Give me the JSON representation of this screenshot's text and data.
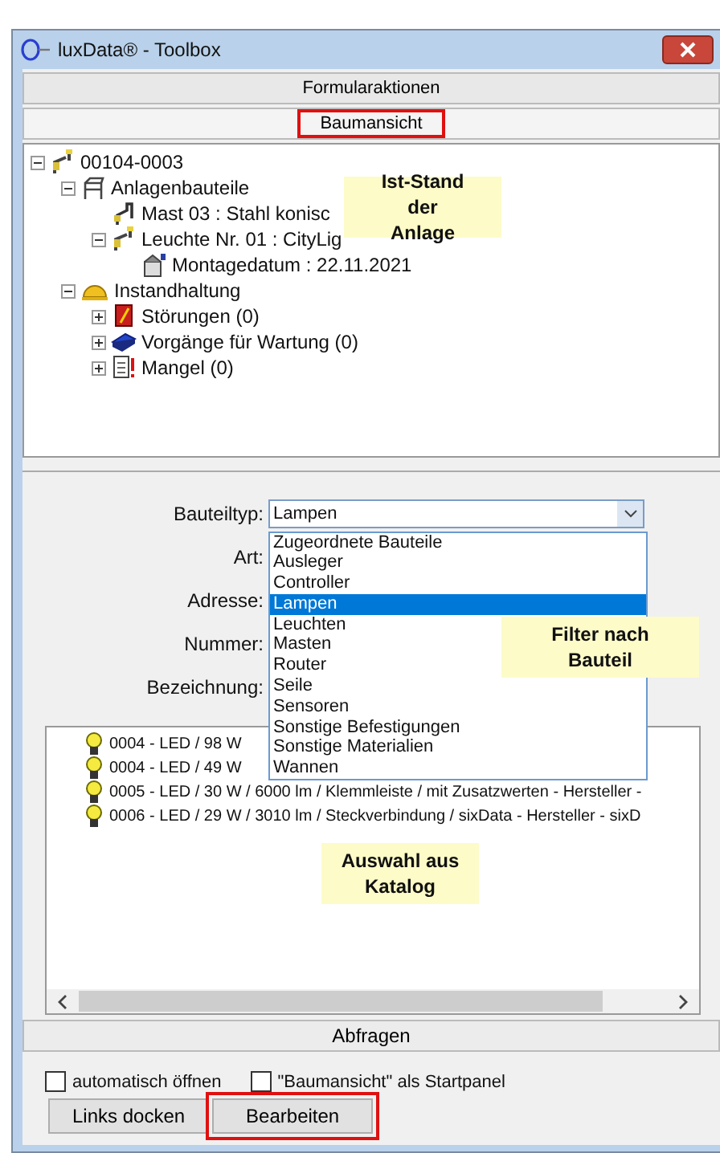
{
  "window": {
    "title": "luxData® - Toolbox"
  },
  "panels": [
    {
      "label": "Formularaktionen",
      "selected": false,
      "highlighted": false
    },
    {
      "label": "Baumansicht",
      "selected": true,
      "highlighted": true
    }
  ],
  "tree": {
    "nodes": [
      {
        "label": "00104-0003",
        "kind": "pole",
        "expanded": true,
        "children": [
          {
            "label": "Anlagenbauteile",
            "kind": "assembly",
            "expanded": true,
            "children": [
              {
                "label": "Mast 03 : Stahl konisc",
                "kind": "mast"
              },
              {
                "label": "Leuchte Nr. 01 : CityLig",
                "kind": "pole",
                "expanded": true,
                "children": [
                  {
                    "label": "Montagedatum : 22.11.2021",
                    "kind": "date"
                  }
                ]
              }
            ]
          },
          {
            "label": "Instandhaltung",
            "kind": "helmet",
            "expanded": true,
            "children": [
              {
                "label": "Störungen (0)",
                "kind": "fault",
                "expanded": false
              },
              {
                "label": "Vorgänge für Wartung (0)",
                "kind": "book",
                "expanded": false
              },
              {
                "label": "Mangel (0)",
                "kind": "defect",
                "expanded": false
              }
            ]
          }
        ]
      }
    ]
  },
  "callouts": [
    {
      "text": "Ist-Stand der Anlage"
    },
    {
      "text": "Filter nach Bauteil"
    },
    {
      "text": "Auswahl aus Katalog"
    }
  ],
  "filter": {
    "fields": [
      {
        "label": "Bauteiltyp:",
        "kind": "combo",
        "value": "Lampen"
      },
      {
        "label": "Art:",
        "kind": "text"
      },
      {
        "label": "Adresse:",
        "kind": "text"
      },
      {
        "label": "Nummer:",
        "kind": "text"
      },
      {
        "label": "Bezeichnung:",
        "kind": "text"
      }
    ],
    "options": [
      {
        "label": "Zugeordnete Bauteile",
        "selected": false
      },
      {
        "label": "Ausleger",
        "selected": false
      },
      {
        "label": "Controller",
        "selected": false
      },
      {
        "label": "Lampen",
        "selected": true
      },
      {
        "label": "Leuchten",
        "selected": false
      },
      {
        "label": "Masten",
        "selected": false
      },
      {
        "label": "Router",
        "selected": false
      },
      {
        "label": "Seile",
        "selected": false
      },
      {
        "label": "Sensoren",
        "selected": false
      },
      {
        "label": "Sonstige Befestigungen",
        "selected": false
      },
      {
        "label": "Sonstige Materialien",
        "selected": false
      },
      {
        "label": "Wannen",
        "selected": false
      }
    ]
  },
  "catalog": {
    "rows": [
      "0004 - LED  / 98 W",
      "0004 - LED / 49 W",
      "0005 - LED  / 30 W / 6000 lm / Klemmleiste / mit Zusatzwerten - Hersteller -",
      "0006 - LED  / 29 W / 3010 lm / Steckverbindung / sixData - Hersteller - sixD"
    ]
  },
  "query_button": "Abfragen",
  "options": [
    {
      "label": "automatisch öffnen",
      "checked": false
    },
    {
      "label": "\"Baumansicht\" als Startpanel",
      "checked": false
    }
  ],
  "buttons": [
    {
      "label": "Links docken",
      "highlighted": false
    },
    {
      "label": "Bearbeiten",
      "highlighted": true
    }
  ]
}
